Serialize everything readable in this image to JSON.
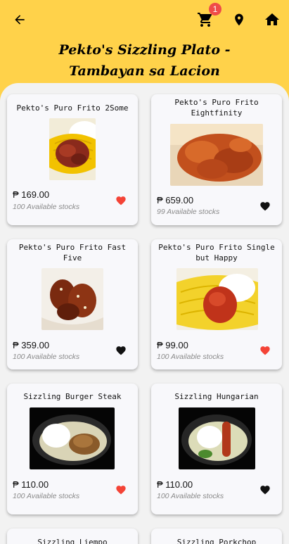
{
  "header": {
    "title_line1": "Pekto's Sizzling Plato -",
    "title_line2": "Tambayan sa Lacion",
    "cart_count": "1"
  },
  "colors": {
    "header_bg": "#ffd24a",
    "heart_active": "#f44336",
    "heart_inactive": "#111111"
  },
  "icons": {
    "back": "arrow-back-icon",
    "cart": "shopping-cart-icon",
    "location": "location-pin-icon",
    "home": "home-icon"
  },
  "products": [
    {
      "name": "Pekto's Puro Frito 2Some",
      "price": "₱ 169.00",
      "stock": "100 Available stocks",
      "favorite": true
    },
    {
      "name": "Pekto's Puro Frito Eightfinity",
      "price": "₱ 659.00",
      "stock": "99 Available stocks",
      "favorite": false
    },
    {
      "name": "Pekto's Puro Frito Fast Five",
      "price": "₱ 359.00",
      "stock": "100 Available stocks",
      "favorite": false
    },
    {
      "name": "Pekto's Puro Frito Single but Happy",
      "price": "₱ 99.00",
      "stock": "100 Available stocks",
      "favorite": true
    },
    {
      "name": "Sizzling Burger Steak",
      "price": "₱ 110.00",
      "stock": "100 Available stocks",
      "favorite": true
    },
    {
      "name": "Sizzling Hungarian",
      "price": "₱ 110.00",
      "stock": "100 Available stocks",
      "favorite": false
    },
    {
      "name": "Sizzling Liempo",
      "price": "",
      "stock": "",
      "favorite": false
    },
    {
      "name": "Sizzling Porkchop",
      "price": "",
      "stock": "",
      "favorite": false
    }
  ]
}
